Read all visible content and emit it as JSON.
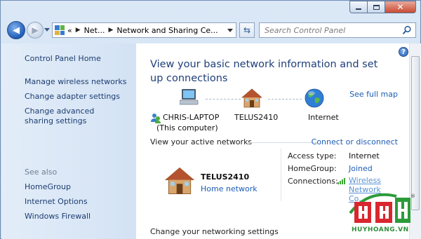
{
  "window": {
    "caption_buttons": {
      "minimize": "minimize",
      "maximize": "maximize",
      "close": "✕"
    }
  },
  "nav": {
    "overflow": "«",
    "breadcrumbs": [
      "Net...",
      "Network and Sharing Ce..."
    ],
    "search_placeholder": "Search Control Panel"
  },
  "sidebar": {
    "items": [
      "Control Panel Home",
      "Manage wireless networks",
      "Change adapter settings",
      "Change advanced sharing settings"
    ],
    "see_also_heading": "See also",
    "see_also": [
      "HomeGroup",
      "Internet Options",
      "Windows Firewall"
    ]
  },
  "main": {
    "help": "?",
    "title": "View your basic network information and set up connections",
    "see_full_map": "See full map",
    "map": {
      "computer_name": "CHRIS-LAPTOP",
      "computer_sub": "(This computer)",
      "router": "TELUS2410",
      "internet": "Internet"
    },
    "active_networks_heading": "View your active networks",
    "connect_link": "Connect or disconnect",
    "active_network": {
      "name": "TELUS2410",
      "type": "Home network",
      "access_type_label": "Access type:",
      "access_type_value": "Internet",
      "homegroup_label": "HomeGroup:",
      "homegroup_value": "Joined",
      "connections_label": "Connections:",
      "connections_value": "Wireless Network Co..."
    },
    "change_settings_heading": "Change your networking settings"
  },
  "watermark": {
    "text": "HUYHOANG.VN",
    "mark": "®"
  },
  "colors": {
    "link": "#1d5db6",
    "title": "#1e3f7a",
    "sidebar_link": "#1c3d70"
  }
}
